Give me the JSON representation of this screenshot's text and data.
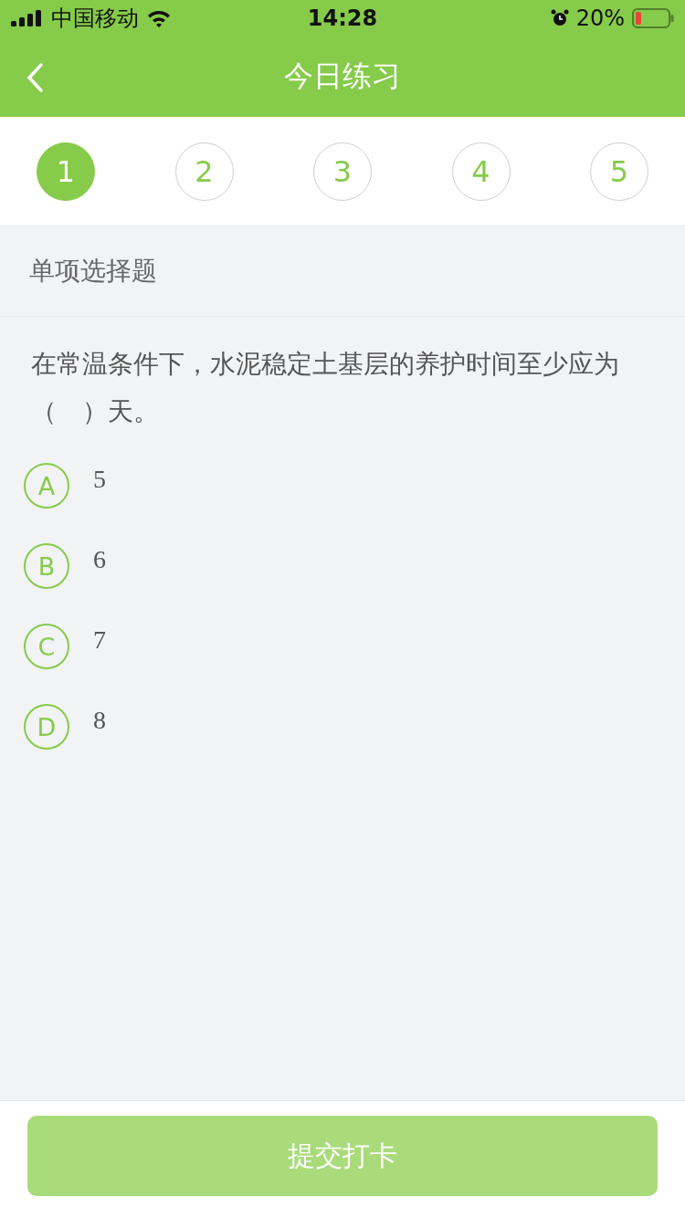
{
  "status_bar": {
    "carrier": "中国移动",
    "time": "14:28",
    "battery": "20%"
  },
  "nav": {
    "title": "今日练习"
  },
  "steps": [
    {
      "label": "1",
      "selected": true
    },
    {
      "label": "2",
      "selected": false
    },
    {
      "label": "3",
      "selected": false
    },
    {
      "label": "4",
      "selected": false
    },
    {
      "label": "5",
      "selected": false
    }
  ],
  "section": {
    "title": "单项选择题"
  },
  "question": {
    "text": "在常温条件下，水泥稳定土基层的养护时间至少应为（　）天。"
  },
  "options": [
    {
      "letter": "A",
      "text": "5",
      "selected": false
    },
    {
      "letter": "B",
      "text": "6",
      "selected": false
    },
    {
      "letter": "C",
      "text": "7",
      "selected": false
    },
    {
      "letter": "D",
      "text": "8",
      "selected": false
    }
  ],
  "submit": {
    "label": "提交打卡",
    "disabled": true
  }
}
